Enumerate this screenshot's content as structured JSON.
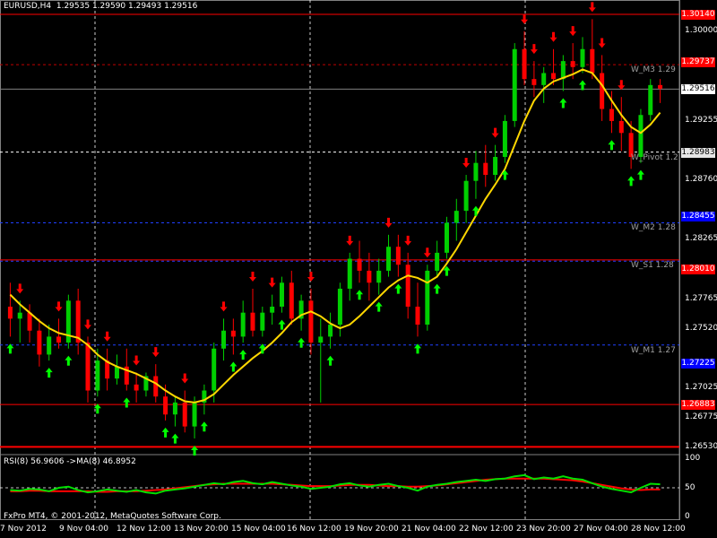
{
  "header": {
    "symbol_tf": "EURUSD,H4",
    "ohlc": "1.29535 1.29590 1.29493 1.29516"
  },
  "price_axis": [
    {
      "label": "1.30140",
      "tag": true,
      "bg": "#ff0000"
    },
    {
      "label": "1.30000",
      "tag": false
    },
    {
      "label": "1.29737",
      "tag": true,
      "bg": "#ff0000"
    },
    {
      "label": "1.29516",
      "tag": true,
      "bg": "#ffffff",
      "fg": "#000000"
    },
    {
      "label": "1.29255",
      "tag": false
    },
    {
      "label": "1.28983",
      "tag": true,
      "bg": "#e6e6e6",
      "fg": "#000000"
    },
    {
      "label": "1.28760",
      "tag": false
    },
    {
      "label": "1.28455",
      "tag": true,
      "bg": "#0000ff"
    },
    {
      "label": "1.28265",
      "tag": false
    },
    {
      "label": "1.28010",
      "tag": true,
      "bg": "#ff0000"
    },
    {
      "label": "1.27765",
      "tag": false
    },
    {
      "label": "1.27520",
      "tag": false
    },
    {
      "label": "1.27225",
      "tag": true,
      "bg": "#0000ff"
    },
    {
      "label": "1.27025",
      "tag": false
    },
    {
      "label": "1.26775",
      "tag": false
    },
    {
      "label": "1.26883",
      "tag": true,
      "bg": "#ff0000"
    },
    {
      "label": "1.26530",
      "tag": false
    }
  ],
  "levels": [
    {
      "name": "W_M3 1.29",
      "price": 1.2972
    },
    {
      "name": "W_Pivot 1.2",
      "price": 1.2899
    },
    {
      "name": "W_M2 1.28",
      "price": 1.284
    },
    {
      "name": "W_S1 1.28",
      "price": 1.2809
    },
    {
      "name": "W_M1 1.27",
      "price": 1.2738
    }
  ],
  "time_axis": [
    "7 Nov 2012",
    "9 Nov 04:00",
    "12 Nov 12:00",
    "13 Nov 20:00",
    "15 Nov 04:00",
    "16 Nov 12:00",
    "19 Nov 20:00",
    "21 Nov 04:00",
    "22 Nov 12:00",
    "23 Nov 20:00",
    "27 Nov 04:00",
    "28 Nov 12:00"
  ],
  "indicator": {
    "title": "RSI(8) 56.9606  ->MA(8) 46.8952",
    "scale": [
      "100",
      "50",
      "0"
    ]
  },
  "footer": {
    "copyright": "FxPro MT4, © 2001-2012, MetaQuotes Software Corp."
  },
  "chart_data": {
    "type": "candlestick",
    "symbol": "EURUSD",
    "timeframe": "H4",
    "ylim": [
      1.2648,
      1.302
    ],
    "candles": [
      [
        1.277,
        1.279,
        1.2745,
        1.276
      ],
      [
        1.276,
        1.2775,
        1.274,
        1.2765
      ],
      [
        1.2765,
        1.2772,
        1.274,
        1.275
      ],
      [
        1.275,
        1.276,
        1.272,
        1.273
      ],
      [
        1.273,
        1.2755,
        1.2725,
        1.2745
      ],
      [
        1.2745,
        1.276,
        1.2735,
        1.274
      ],
      [
        1.274,
        1.278,
        1.2735,
        1.2775
      ],
      [
        1.2775,
        1.2785,
        1.273,
        1.274
      ],
      [
        1.274,
        1.2745,
        1.269,
        1.27
      ],
      [
        1.27,
        1.2735,
        1.2695,
        1.2725
      ],
      [
        1.2725,
        1.2735,
        1.27,
        1.271
      ],
      [
        1.271,
        1.273,
        1.2705,
        1.272
      ],
      [
        1.272,
        1.2735,
        1.27,
        1.2705
      ],
      [
        1.2705,
        1.2715,
        1.269,
        1.27
      ],
      [
        1.27,
        1.2715,
        1.2695,
        1.2712
      ],
      [
        1.2712,
        1.2722,
        1.269,
        1.2695
      ],
      [
        1.2695,
        1.2705,
        1.2675,
        1.268
      ],
      [
        1.268,
        1.2695,
        1.267,
        1.269
      ],
      [
        1.269,
        1.27,
        1.2665,
        1.267
      ],
      [
        1.267,
        1.2695,
        1.266,
        1.269
      ],
      [
        1.269,
        1.2705,
        1.268,
        1.27
      ],
      [
        1.27,
        1.274,
        1.269,
        1.2735
      ],
      [
        1.2735,
        1.276,
        1.2725,
        1.275
      ],
      [
        1.275,
        1.276,
        1.273,
        1.2745
      ],
      [
        1.2745,
        1.2775,
        1.274,
        1.2765
      ],
      [
        1.2765,
        1.2785,
        1.2745,
        1.275
      ],
      [
        1.275,
        1.277,
        1.2745,
        1.2765
      ],
      [
        1.2765,
        1.278,
        1.2755,
        1.277
      ],
      [
        1.277,
        1.2795,
        1.2765,
        1.279
      ],
      [
        1.279,
        1.28,
        1.2755,
        1.276
      ],
      [
        1.276,
        1.278,
        1.275,
        1.2775
      ],
      [
        1.2775,
        1.2785,
        1.273,
        1.274
      ],
      [
        1.274,
        1.276,
        1.269,
        1.2745
      ],
      [
        1.2745,
        1.2765,
        1.2735,
        1.2755
      ],
      [
        1.2755,
        1.279,
        1.2745,
        1.2785
      ],
      [
        1.2785,
        1.2815,
        1.2775,
        1.281
      ],
      [
        1.281,
        1.2825,
        1.279,
        1.28
      ],
      [
        1.28,
        1.2815,
        1.2775,
        1.279
      ],
      [
        1.279,
        1.281,
        1.278,
        1.28
      ],
      [
        1.28,
        1.283,
        1.2795,
        1.282
      ],
      [
        1.282,
        1.283,
        1.2795,
        1.2805
      ],
      [
        1.2805,
        1.2815,
        1.276,
        1.277
      ],
      [
        1.277,
        1.279,
        1.2745,
        1.2755
      ],
      [
        1.2755,
        1.2805,
        1.275,
        1.28
      ],
      [
        1.28,
        1.2825,
        1.2795,
        1.2815
      ],
      [
        1.2815,
        1.2845,
        1.281,
        1.284
      ],
      [
        1.284,
        1.286,
        1.2825,
        1.285
      ],
      [
        1.285,
        1.288,
        1.284,
        1.2875
      ],
      [
        1.2875,
        1.29,
        1.286,
        1.289
      ],
      [
        1.289,
        1.2905,
        1.287,
        1.288
      ],
      [
        1.288,
        1.2905,
        1.2875,
        1.2895
      ],
      [
        1.2895,
        1.293,
        1.289,
        1.2925
      ],
      [
        1.2925,
        1.299,
        1.292,
        1.2985
      ],
      [
        1.2985,
        1.3,
        1.2955,
        1.296
      ],
      [
        1.296,
        1.2975,
        1.2945,
        1.2955
      ],
      [
        1.2955,
        1.297,
        1.294,
        1.2965
      ],
      [
        1.2965,
        1.2985,
        1.2955,
        1.296
      ],
      [
        1.296,
        1.298,
        1.295,
        1.2975
      ],
      [
        1.2975,
        1.299,
        1.296,
        1.297
      ],
      [
        1.297,
        1.2995,
        1.2965,
        1.2985
      ],
      [
        1.2985,
        1.301,
        1.296,
        1.2965
      ],
      [
        1.2965,
        1.298,
        1.2925,
        1.2935
      ],
      [
        1.2935,
        1.295,
        1.2915,
        1.2925
      ],
      [
        1.2925,
        1.2945,
        1.29,
        1.2915
      ],
      [
        1.2915,
        1.2925,
        1.2885,
        1.2895
      ],
      [
        1.2895,
        1.2935,
        1.289,
        1.293
      ],
      [
        1.293,
        1.296,
        1.2925,
        1.2955
      ],
      [
        1.2955,
        1.296,
        1.294,
        1.2952
      ]
    ],
    "ma": [
      1.278,
      1.2772,
      1.2765,
      1.2758,
      1.2752,
      1.2748,
      1.2746,
      1.2744,
      1.2738,
      1.273,
      1.2724,
      1.272,
      1.2717,
      1.2714,
      1.271,
      1.2706,
      1.27,
      1.2695,
      1.2691,
      1.269,
      1.2692,
      1.2697,
      1.2705,
      1.2713,
      1.272,
      1.2727,
      1.2733,
      1.274,
      1.2748,
      1.2757,
      1.2763,
      1.2766,
      1.2762,
      1.2756,
      1.2752,
      1.2755,
      1.2762,
      1.277,
      1.2778,
      1.2786,
      1.2792,
      1.2796,
      1.2794,
      1.279,
      1.2795,
      1.2806,
      1.2818,
      1.2832,
      1.2846,
      1.286,
      1.2872,
      1.2885,
      1.2905,
      1.2925,
      1.2942,
      1.2952,
      1.2958,
      1.2961,
      1.2964,
      1.2968,
      1.2965,
      1.2955,
      1.2942,
      1.293,
      1.292,
      1.2915,
      1.2922,
      1.2932
    ],
    "up_arrows": [
      0,
      4,
      6,
      9,
      12,
      16,
      17,
      19,
      20,
      23,
      24,
      26,
      28,
      30,
      33,
      36,
      38,
      40,
      42,
      44,
      45,
      48,
      51,
      57,
      59,
      62,
      64,
      65
    ],
    "down_arrows": [
      1,
      5,
      8,
      10,
      13,
      15,
      18,
      22,
      25,
      27,
      31,
      35,
      39,
      41,
      43,
      47,
      50,
      53,
      54,
      56,
      58,
      60,
      61,
      63
    ],
    "rsi": [
      46,
      45,
      48,
      47,
      44,
      50,
      52,
      46,
      42,
      44,
      47,
      45,
      43,
      46,
      42,
      40,
      45,
      47,
      49,
      52,
      55,
      58,
      56,
      60,
      62,
      58,
      56,
      60,
      57,
      54,
      52,
      48,
      50,
      52,
      56,
      58,
      54,
      52,
      55,
      57,
      53,
      50,
      45,
      52,
      55,
      57,
      60,
      62,
      64,
      62,
      65,
      66,
      70,
      72,
      65,
      68,
      66,
      70,
      66,
      64,
      58,
      52,
      48,
      45,
      42,
      50,
      57,
      56
    ],
    "rsi_ma": [
      44,
      44,
      45,
      45,
      44,
      44,
      44,
      44,
      44,
      43,
      43,
      44,
      44,
      44,
      45,
      46,
      47,
      49,
      51,
      53,
      55,
      56,
      57,
      57,
      57,
      57,
      57,
      57,
      56,
      55,
      54,
      53,
      53,
      53,
      54,
      55,
      55,
      55,
      54,
      53,
      53,
      52,
      52,
      53,
      54,
      56,
      58,
      60,
      62,
      64,
      65,
      66,
      66,
      66,
      66,
      66,
      65,
      64,
      63,
      61,
      58,
      55,
      52,
      49,
      47,
      46,
      47,
      47
    ]
  }
}
